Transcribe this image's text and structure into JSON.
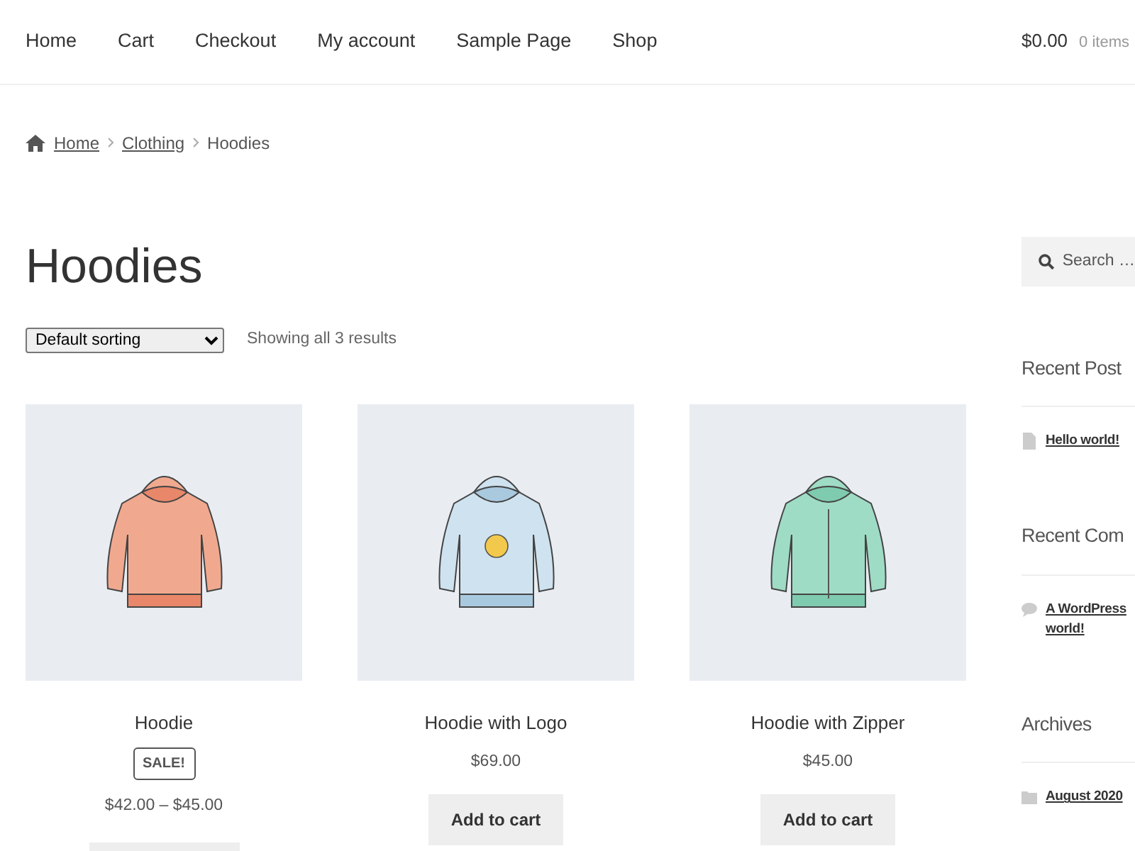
{
  "nav": {
    "items": [
      "Home",
      "Cart",
      "Checkout",
      "My account",
      "Sample Page",
      "Shop"
    ],
    "cart_total": "$0.00",
    "cart_count": "0 items"
  },
  "breadcrumb": [
    "Home",
    "Clothing",
    "Hoodies"
  ],
  "page_title": "Hoodies",
  "sorting": {
    "value": "Default sorting"
  },
  "result_count": "Showing all 3 results",
  "products": [
    {
      "name": "Hoodie",
      "badge": "SALE!",
      "price": "$42.00 – $45.00",
      "button_partly_hidden": true
    },
    {
      "name": "Hoodie with Logo",
      "price": "$69.00",
      "button": "Add to cart"
    },
    {
      "name": "Hoodie with Zipper",
      "price": "$45.00",
      "button": "Add to cart"
    }
  ],
  "sidebar": {
    "search_placeholder": "Search …",
    "widgets": [
      {
        "kind": "posts",
        "title": "Recent Post",
        "links": [
          [
            "Hello world!"
          ]
        ]
      },
      {
        "kind": "comments",
        "title": "Recent Com",
        "links": [
          [
            "A WordPress",
            "world!"
          ]
        ]
      },
      {
        "kind": "archives",
        "title": "Archives",
        "links": [
          [
            "August 2020"
          ]
        ]
      }
    ]
  }
}
